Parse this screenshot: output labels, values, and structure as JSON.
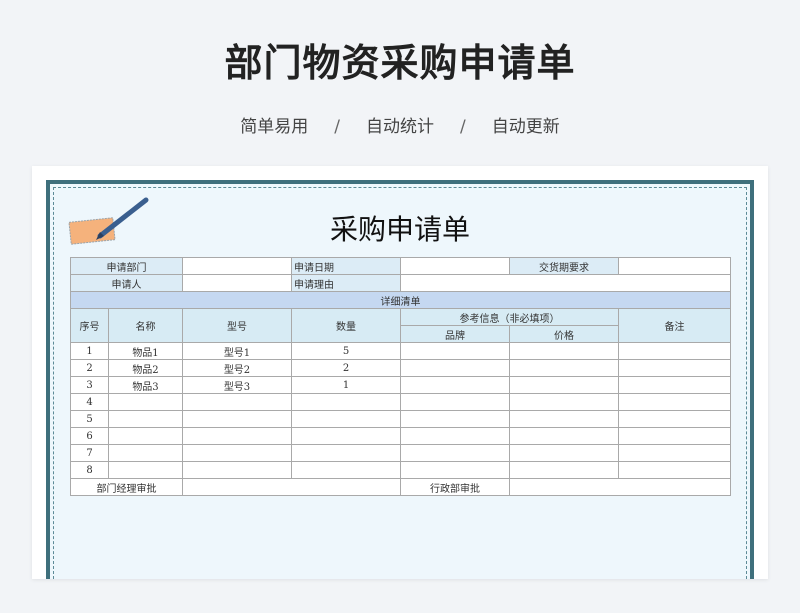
{
  "header": {
    "title": "部门物资采购申请单",
    "tags": [
      "简单易用",
      "自动统计",
      "自动更新"
    ],
    "separator": "/"
  },
  "form": {
    "title": "采购申请单",
    "info": {
      "dept_label": "申请部门",
      "date_label": "申请日期",
      "delivery_label": "交货期要求",
      "applicant_label": "申请人",
      "reason_label": "申请理由"
    },
    "section_title": "详细清单",
    "columns": {
      "no": "序号",
      "name": "名称",
      "model": "型号",
      "qty": "数量",
      "ref": "参考信息（非必填项）",
      "brand": "品牌",
      "price": "价格",
      "note": "备注"
    },
    "rows": [
      {
        "no": "1",
        "name": "物品1",
        "model": "型号1",
        "qty": "5"
      },
      {
        "no": "2",
        "name": "物品2",
        "model": "型号2",
        "qty": "2"
      },
      {
        "no": "3",
        "name": "物品3",
        "model": "型号3",
        "qty": "1"
      },
      {
        "no": "4",
        "name": "",
        "model": "",
        "qty": ""
      },
      {
        "no": "5",
        "name": "",
        "model": "",
        "qty": ""
      },
      {
        "no": "6",
        "name": "",
        "model": "",
        "qty": ""
      },
      {
        "no": "7",
        "name": "",
        "model": "",
        "qty": ""
      },
      {
        "no": "8",
        "name": "",
        "model": "",
        "qty": ""
      }
    ],
    "approval": {
      "dept_manager": "部门经理审批",
      "admin_dept": "行政部审批"
    }
  },
  "colors": {
    "frame": "#3e6f7c",
    "label_bg": "#dcecf6",
    "section_bg": "#c5d8f1",
    "note_paper": "#f5b27c",
    "pen": "#3a5f8f"
  },
  "icons": [
    "pen-note-icon"
  ]
}
